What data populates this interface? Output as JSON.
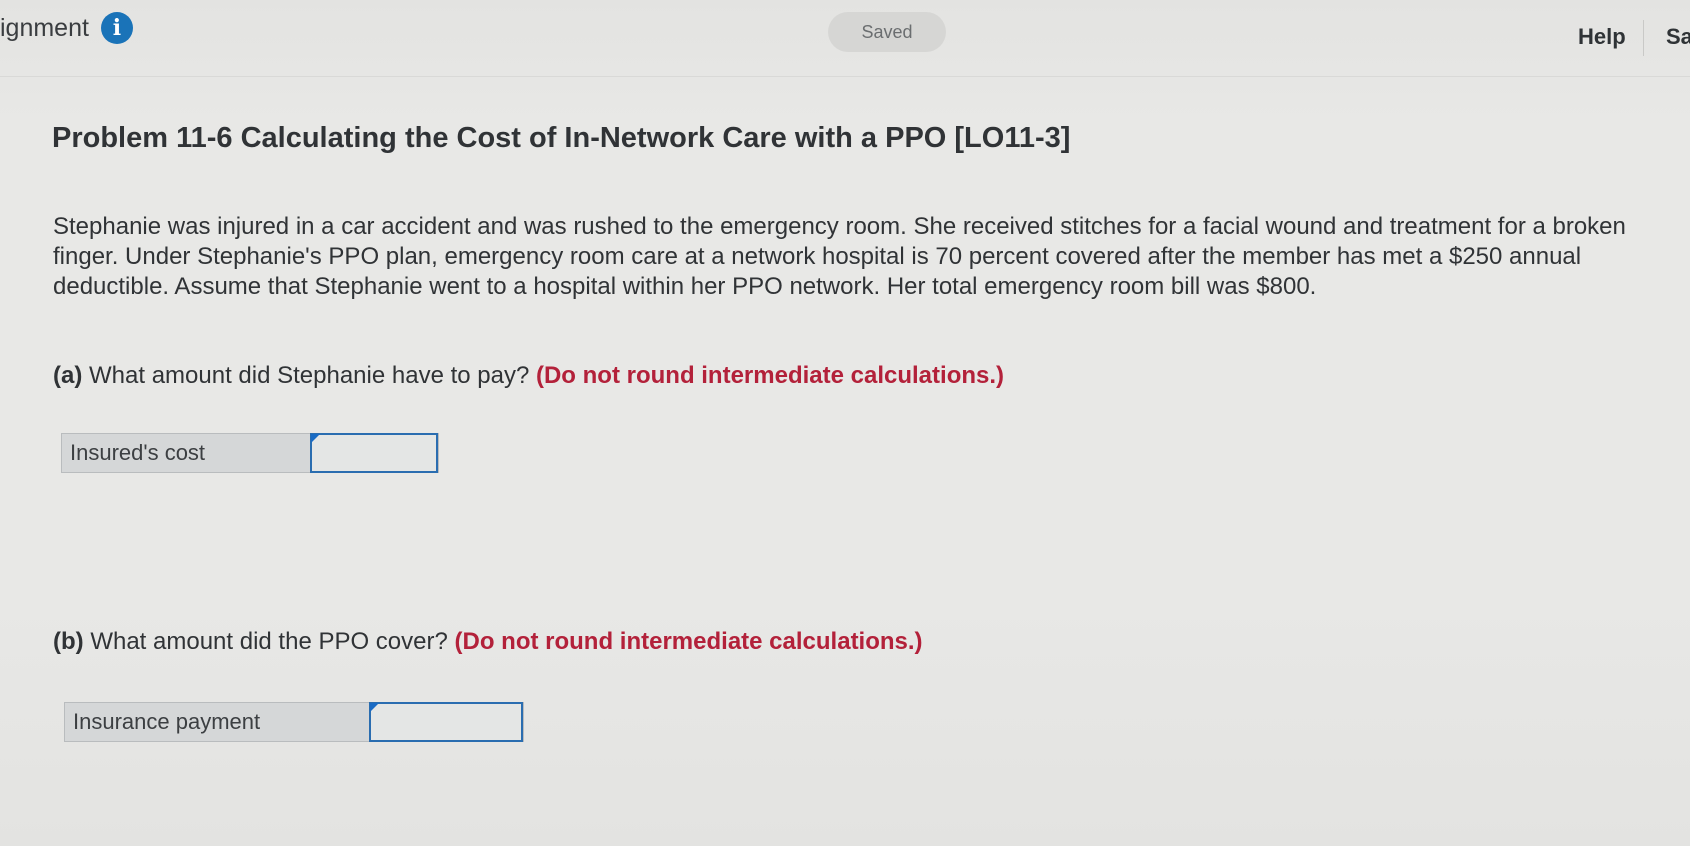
{
  "header": {
    "assignment_title": "ignment",
    "saved_label": "Saved",
    "help_label": "Help",
    "save_label": "Sa"
  },
  "problem": {
    "title": "Problem 11-6 Calculating the Cost of In-Network Care with a PPO [LO11-3]",
    "text": "Stephanie was injured in a car accident and was rushed to the emergency room. She received stitches for a facial wound and treatment for a broken finger. Under Stephanie's PPO plan, emergency room care at a network hospital is 70 percent covered after the member has met a $250 annual deductible. Assume that Stephanie went to a hospital within her PPO network. Her total emergency room bill was $800."
  },
  "questions": {
    "a": {
      "letter": "(a)",
      "text": "What amount did Stephanie have to pay?",
      "note": "(Do not round intermediate calculations.)",
      "field_label": "Insured's cost",
      "field_value": ""
    },
    "b": {
      "letter": "(b)",
      "text": "What amount did the PPO cover?",
      "note": "(Do not round intermediate calculations.)",
      "field_label": "Insurance payment",
      "field_value": ""
    }
  },
  "icons": {
    "info": "info-icon"
  },
  "colors": {
    "info_icon": "#1a73b8",
    "note_red": "#b3213a",
    "input_border": "#2a6db0"
  }
}
